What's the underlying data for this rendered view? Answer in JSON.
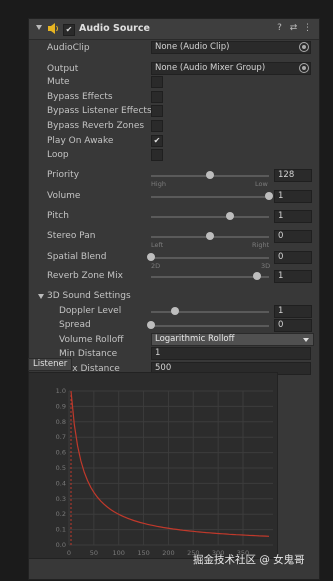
{
  "component": {
    "title": "Audio Source"
  },
  "props": {
    "audio_clip": {
      "label": "AudioClip",
      "value": "None (Audio Clip)"
    },
    "output": {
      "label": "Output",
      "value": "None (Audio Mixer Group)"
    },
    "mute": {
      "label": "Mute",
      "checked": false
    },
    "bypass_effects": {
      "label": "Bypass Effects",
      "checked": false
    },
    "bypass_listener_effects": {
      "label": "Bypass Listener Effects",
      "checked": false
    },
    "bypass_reverb_zones": {
      "label": "Bypass Reverb Zones",
      "checked": false
    },
    "play_on_awake": {
      "label": "Play On Awake",
      "checked": true
    },
    "loop": {
      "label": "Loop",
      "checked": false
    },
    "priority": {
      "label": "Priority",
      "value": "128",
      "min_label": "High",
      "max_label": "Low",
      "level": 0.5
    },
    "volume": {
      "label": "Volume",
      "value": "1",
      "level": 1.0
    },
    "pitch": {
      "label": "Pitch",
      "value": "1",
      "level": 0.67
    },
    "stereo_pan": {
      "label": "Stereo Pan",
      "value": "0",
      "min_label": "Left",
      "max_label": "Right",
      "level": 0.5
    },
    "spatial_blend": {
      "label": "Spatial Blend",
      "value": "0",
      "min_label": "2D",
      "max_label": "3D",
      "level": 0.0
    },
    "reverb_zone_mix": {
      "label": "Reverb Zone Mix",
      "value": "1",
      "level": 0.9
    }
  },
  "sound3d": {
    "title": "3D Sound Settings",
    "doppler_level": {
      "label": "Doppler Level",
      "value": "1",
      "level": 0.2
    },
    "spread": {
      "label": "Spread",
      "value": "0",
      "level": 0.0
    },
    "volume_rolloff": {
      "label": "Volume Rolloff",
      "value": "Logarithmic Rolloff"
    },
    "min_distance": {
      "label": "Min Distance",
      "value": "1"
    },
    "max_distance": {
      "label": "Max Distance",
      "value": "500"
    }
  },
  "graph": {
    "tab_label": "Listener",
    "y_ticks": [
      "0.0",
      "0.1",
      "0.2",
      "0.3",
      "0.4",
      "0.5",
      "0.6",
      "0.7",
      "0.8",
      "0.9",
      "1.0"
    ],
    "x_ticks": [
      "0",
      "50",
      "100",
      "150",
      "200",
      "250",
      "300",
      "350"
    ]
  },
  "watermark": "掘金技术社区 @ 女鬼哥",
  "colors": {
    "panel_bg": "#383838",
    "curve_red": "#c0392b",
    "slider_knob": "#bdbdbd"
  },
  "icons": {
    "header_fold": "chevron-down-icon",
    "component": "speaker-icon",
    "help": "help-icon",
    "presets": "sliders-icon",
    "menu": "kebab-menu-icon",
    "object_picker": "object-picker-icon"
  }
}
